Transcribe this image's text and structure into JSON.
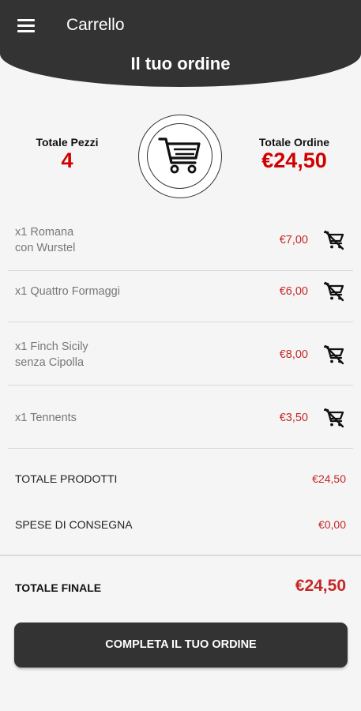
{
  "header": {
    "app_title": "Carrello",
    "title": "Il tuo ordine"
  },
  "summary": {
    "pieces_label": "Totale Pezzi",
    "pieces_value": "4",
    "order_label": "Totale Ordine",
    "order_value": "€24,50"
  },
  "items": [
    {
      "name": "x1 Romana\ncon Wurstel",
      "price": "€7,00"
    },
    {
      "name": "x1 Quattro Formaggi",
      "price": "€6,00"
    },
    {
      "name": "x1 Finch Sicily\nsenza Cipolla",
      "price": "€8,00"
    },
    {
      "name": "x1 Tennents",
      "price": "€3,50"
    }
  ],
  "totals": {
    "products_label": "TOTALE PRODOTTI",
    "products_value": "€24,50",
    "delivery_label": "SPESE DI CONSEGNA",
    "delivery_value": "€0,00",
    "final_label": "TOTALE FINALE",
    "final_value": "€24,50"
  },
  "cta_label": "COMPLETA IL TUO ORDINE",
  "icons": {
    "menu": "hamburger-menu-icon",
    "cart": "shopping-cart-icon",
    "remove": "remove-from-cart-icon"
  },
  "colors": {
    "header": "#333333",
    "accent": "#d10000",
    "price": "#c62828",
    "background": "#f5f5f5"
  }
}
